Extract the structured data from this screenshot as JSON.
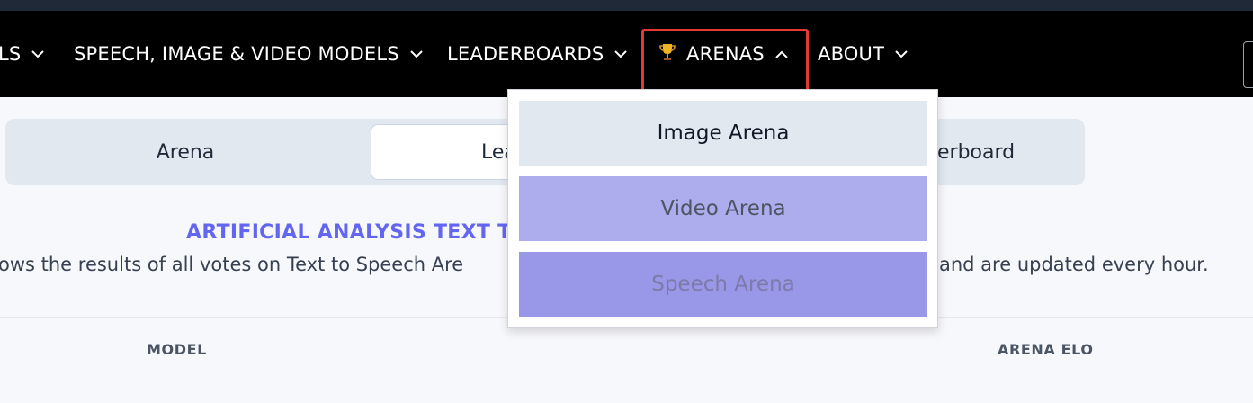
{
  "nav": {
    "items": [
      {
        "label": "LS"
      },
      {
        "label": "SPEECH, IMAGE & VIDEO MODELS"
      },
      {
        "label": "LEADERBOARDS"
      },
      {
        "label": "ARENAS",
        "icon": "trophy-icon",
        "expanded": true
      },
      {
        "label": "ABOUT"
      }
    ]
  },
  "tabs": {
    "arena": "Arena",
    "leaderboard_partial": "Lea",
    "third_partial": "erboard"
  },
  "main": {
    "heading_partial": "ARTIFICIAL ANALYSIS TEXT TO",
    "desc_left": "ows the results of all votes on Text to Speech Are",
    "desc_right": "and are updated every hour."
  },
  "table": {
    "headers": [
      "MODEL",
      "ARENA ELO"
    ]
  },
  "dropdown": {
    "items": [
      {
        "label": "Image Arena"
      },
      {
        "label": "Video Arena"
      },
      {
        "label": "Speech Arena"
      }
    ]
  },
  "colors": {
    "accent": "#6366f1",
    "highlight_border": "#e53935",
    "nav_bg": "#000000"
  }
}
